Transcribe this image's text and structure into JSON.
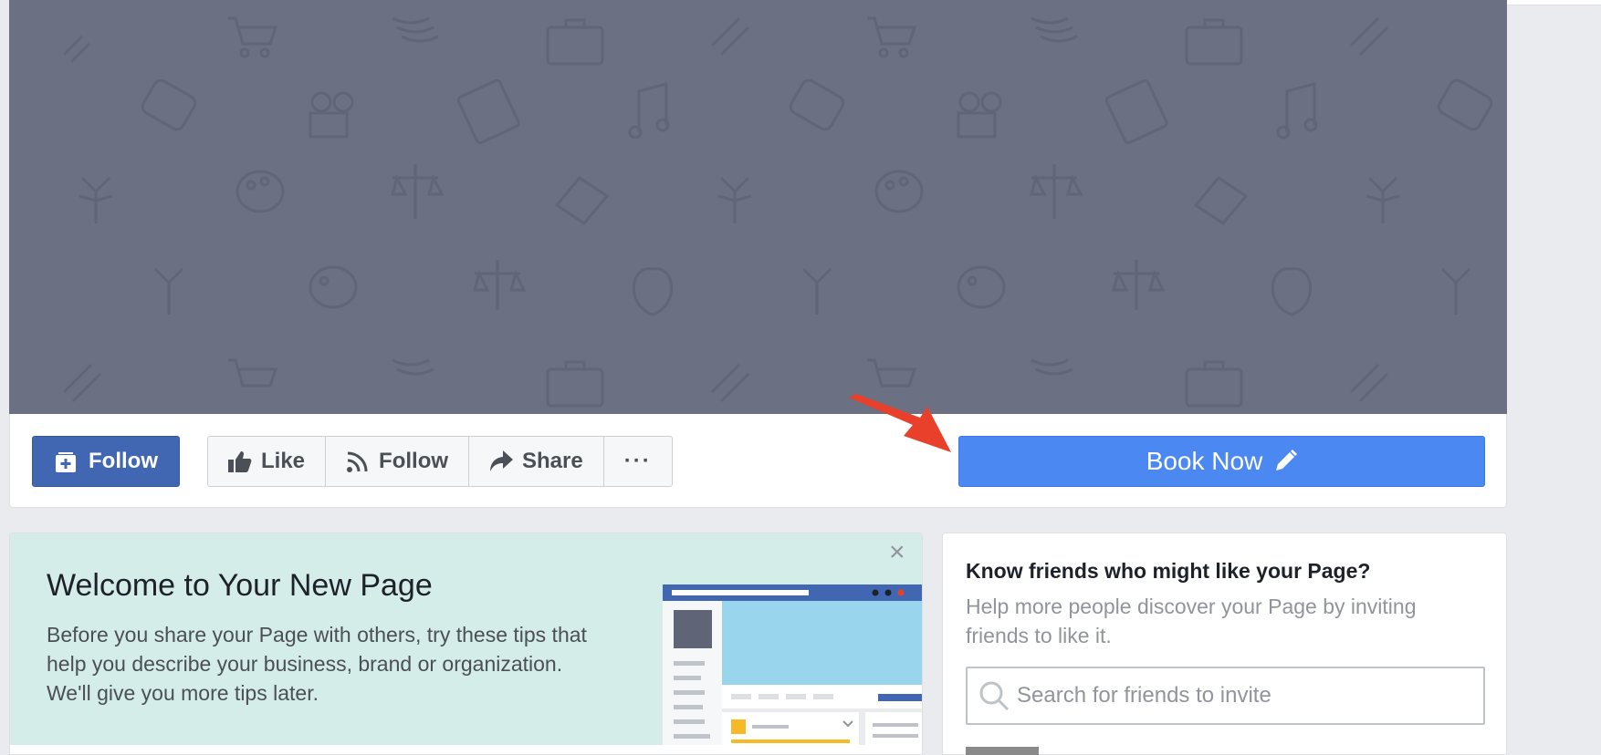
{
  "actions": {
    "follow_primary": "Follow",
    "like": "Like",
    "follow": "Follow",
    "share": "Share",
    "more": "···",
    "book_now": "Book Now"
  },
  "welcome": {
    "title": "Welcome to Your New Page",
    "body": "Before you share your Page with others, try these tips that help you describe your business, brand or organization. We'll give you more tips later.",
    "close": "×"
  },
  "invite": {
    "title": "Know friends who might like your Page?",
    "body": "Help more people discover your Page by inviting friends to like it.",
    "search_placeholder": "Search for friends to invite"
  },
  "colors": {
    "cover": "#6b7182",
    "follow_button": "#4267b2",
    "book_now": "#4c88f2",
    "annotation_arrow": "#e8402a",
    "welcome_bg": "#d5ede8"
  },
  "icons": [
    "follow-plus-icon",
    "thumbs-up-icon",
    "rss-icon",
    "share-arrow-icon",
    "pencil-icon",
    "search-icon",
    "close-icon"
  ]
}
